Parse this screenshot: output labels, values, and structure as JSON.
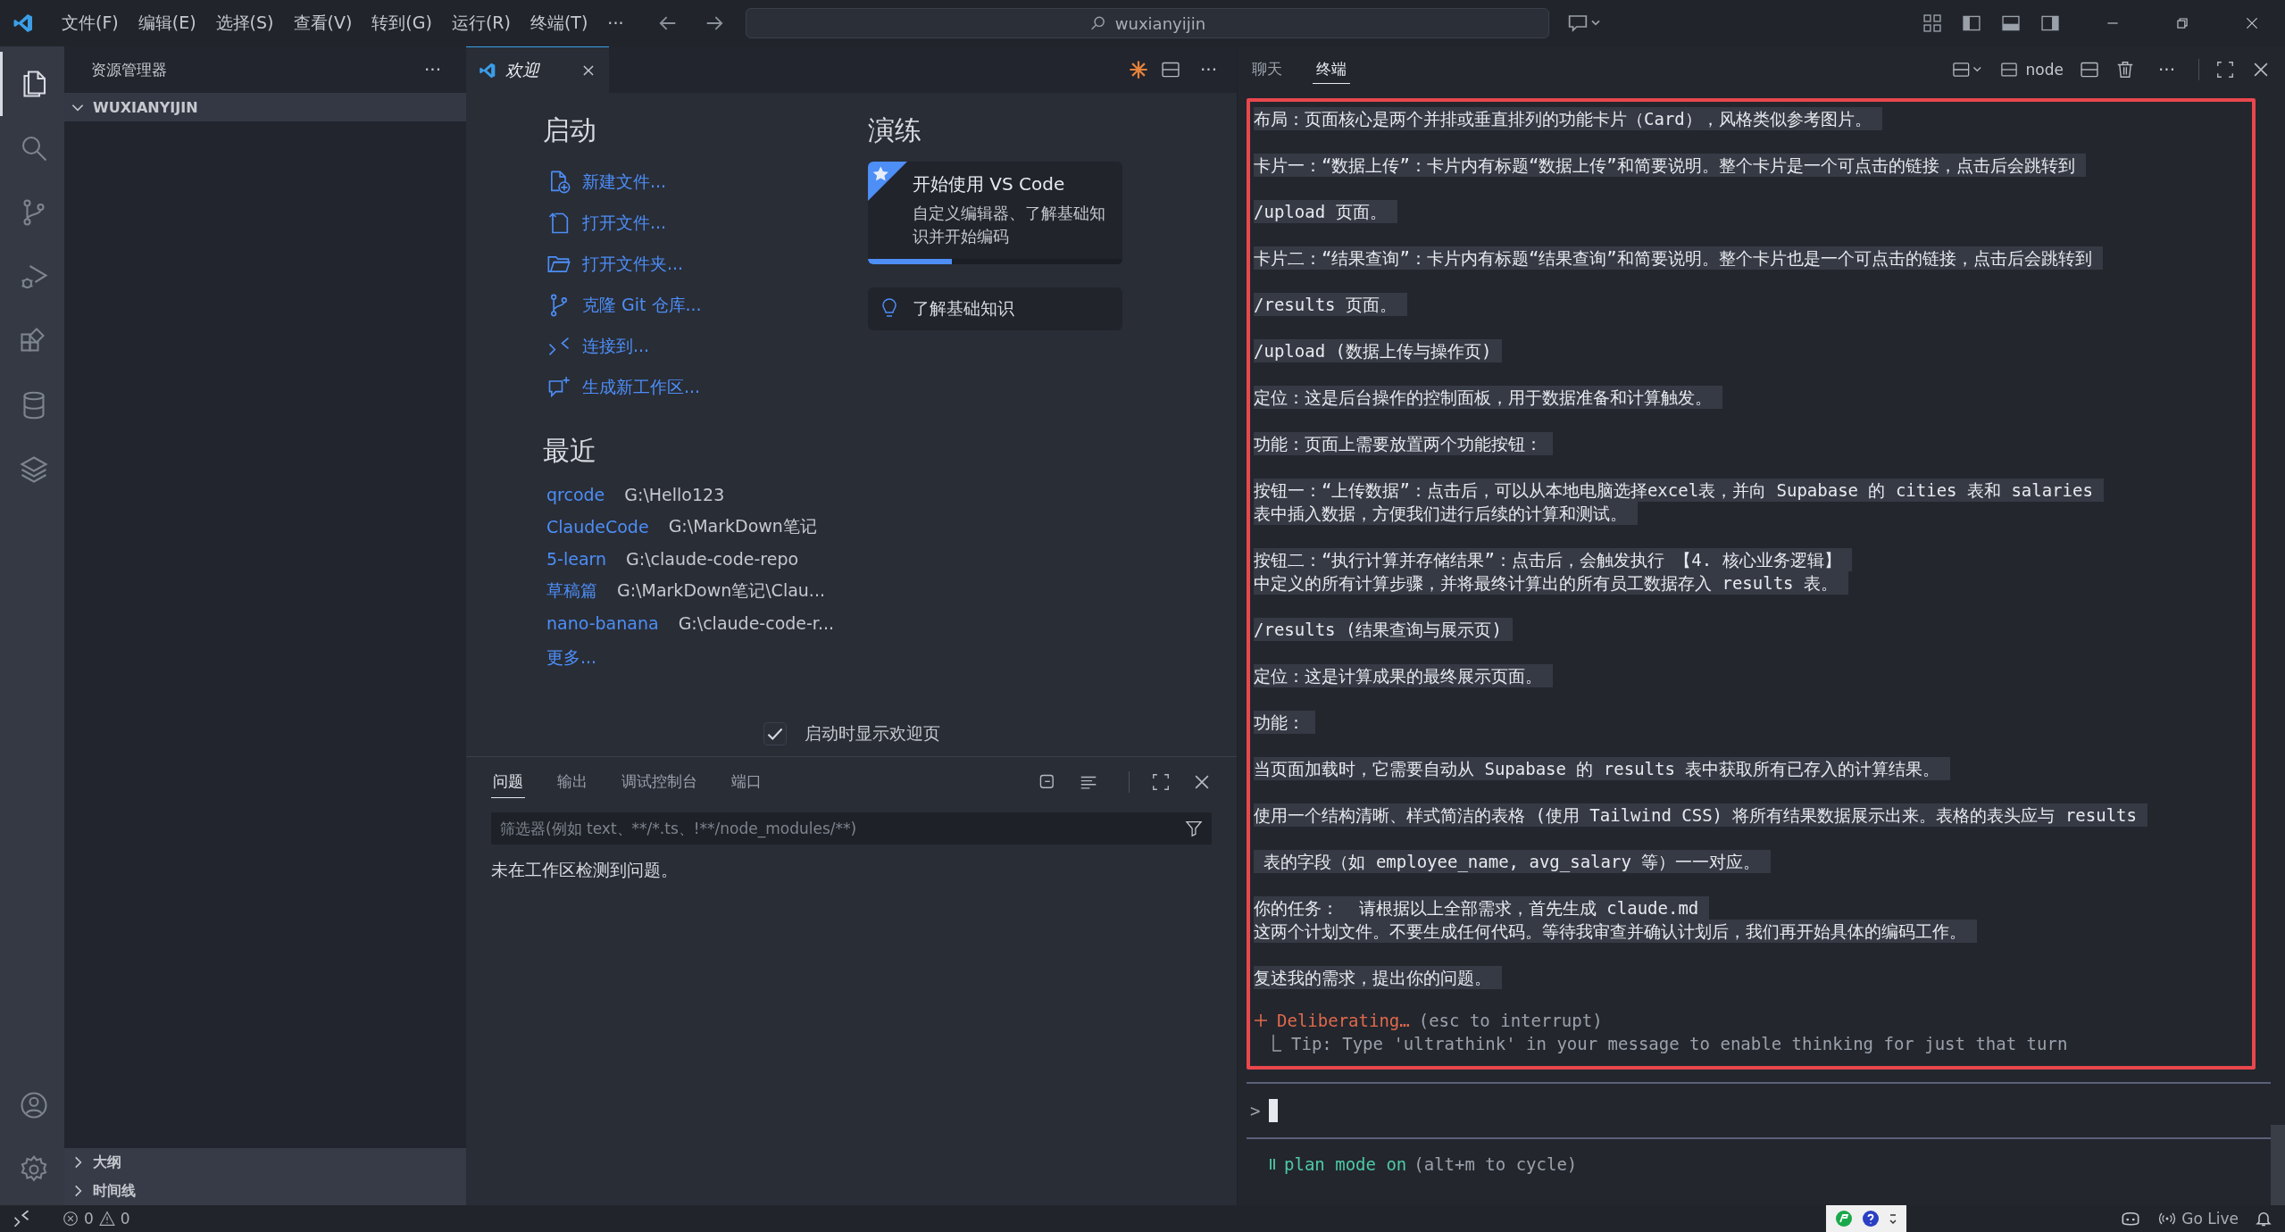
{
  "title_bar": {
    "menus": [
      "文件(F)",
      "编辑(E)",
      "选择(S)",
      "查看(V)",
      "转到(G)",
      "运行(R)",
      "终端(T)"
    ],
    "more": "···",
    "search": "wuxianyijin"
  },
  "activity_bar": {
    "items": [
      {
        "kind": "explorer",
        "selected": true
      },
      {
        "kind": "search",
        "selected": false
      },
      {
        "kind": "source-control",
        "selected": false
      },
      {
        "kind": "run-debug",
        "selected": false
      },
      {
        "kind": "extensions",
        "selected": false
      },
      {
        "kind": "database",
        "selected": false
      },
      {
        "kind": "layers",
        "selected": false
      }
    ],
    "bottom": [
      {
        "kind": "account"
      },
      {
        "kind": "settings"
      }
    ]
  },
  "sidebar": {
    "title": "资源管理器",
    "more": "···",
    "folder": {
      "name": "WUXIANYIJIN",
      "expanded": true
    },
    "sections": [
      {
        "label": "大纲",
        "expanded": false
      },
      {
        "label": "时间线",
        "expanded": false
      }
    ]
  },
  "editor": {
    "tabs": [
      {
        "label": "欢迎",
        "selected": true
      }
    ],
    "more": "···"
  },
  "welcome": {
    "start": {
      "title": "启动",
      "items": [
        {
          "kind": "new-file",
          "label": "新建文件..."
        },
        {
          "kind": "open-file",
          "label": "打开文件..."
        },
        {
          "kind": "open-folder",
          "label": "打开文件夹..."
        },
        {
          "kind": "clone",
          "label": "克隆 Git 仓库..."
        },
        {
          "kind": "connect",
          "label": "连接到..."
        },
        {
          "kind": "generate",
          "label": "生成新工作区..."
        }
      ]
    },
    "walkthroughs": {
      "title": "演练",
      "cards": [
        {
          "kind": "featured",
          "title": "开始使用 VS Code",
          "description": "自定义编辑器、了解基础知识并开始编码",
          "level": 0.33
        },
        {
          "kind": "basic",
          "title": "了解基础知识"
        }
      ]
    },
    "recent": {
      "title": "最近",
      "items": [
        {
          "name": "qrcode",
          "path": "G:\\Hello123"
        },
        {
          "name": "ClaudeCode",
          "path": "G:\\MarkDown笔记"
        },
        {
          "name": "5-learn",
          "path": "G:\\claude-code-repo"
        },
        {
          "name": "草稿篇",
          "path": "G:\\MarkDown笔记\\Clau..."
        },
        {
          "name": "nano-banana",
          "path": "G:\\claude-code-r..."
        }
      ],
      "more": "更多..."
    },
    "show_on_startup": {
      "label": "启动时显示欢迎页",
      "checked": true
    }
  },
  "panel": {
    "tabs": [
      {
        "label": "问题",
        "selected": true
      },
      {
        "label": "输出",
        "selected": false
      },
      {
        "label": "调试控制台",
        "selected": false
      },
      {
        "label": "端口",
        "selected": false
      }
    ],
    "filter": {
      "placeholder": "筛选器(例如 text、**/*.ts、!**/node_modules/**)"
    },
    "message": "未在工作区检测到问题。"
  },
  "secondary": {
    "tabs": [
      {
        "label": "聊天",
        "selected": false
      },
      {
        "label": "终端",
        "selected": true
      }
    ],
    "terminal_name": "node",
    "more": "···",
    "output": [
      [
        "布局：页面核心是两个并排或垂直排列的功能卡片（Card），风格类似参考图片。"
      ],
      [
        "卡片一：“数据上传”：卡片内有标题“数据上传”和简要说明。整个卡片是一个可点击的链接，点击后会跳转到"
      ],
      [
        "/upload 页面。"
      ],
      [
        "卡片二：“结果查询”：卡片内有标题“结果查询”和简要说明。整个卡片也是一个可点击的链接，点击后会跳转到"
      ],
      [
        "/results 页面。"
      ],
      [
        "/upload (数据上传与操作页)"
      ],
      [
        "定位：这是后台操作的控制面板，用于数据准备和计算触发。"
      ],
      [
        "功能：页面上需要放置两个功能按钮："
      ],
      [
        "按钮一：“上传数据”：点击后，可以从本地电脑选择excel表，并向 Supabase 的 cities 表和 salaries",
        "表中插入数据，方便我们进行后续的计算和测试。"
      ],
      [
        "按钮二：“执行计算并存储结果”：点击后，会触发执行 【4. 核心业务逻辑】",
        "中定义的所有计算步骤，并将最终计算出的所有员工数据存入 results 表。"
      ],
      [
        "/results (结果查询与展示页)"
      ],
      [
        "定位：这是计算成果的最终展示页面。"
      ],
      [
        "功能："
      ],
      [
        "当页面加载时，它需要自动从 Supabase 的 results 表中获取所有已存入的计算结果。"
      ],
      [
        "使用一个结构清晰、样式简洁的表格 (使用 Tailwind CSS) 将所有结果数据展示出来。表格的表头应与 results"
      ],
      [
        " 表的字段（如 employee_name, avg_salary 等）一一对应。"
      ],
      [
        "你的任务：  请根据以上全部需求，首先生成 claude.md",
        "这两个计划文件。不要生成任何代码。等待我审查并确认计划后，我们再开始具体的编码工作。"
      ],
      [
        "复述我的需求，提出你的问题。"
      ]
    ],
    "status": {
      "word": "Deliberating…",
      "hint": "(esc to interrupt)"
    },
    "tip": "Tip: Type 'ultrathink' in your message to enable thinking for just that turn",
    "prompt": ">",
    "mode": {
      "label": "plan mode on",
      "hint": "(alt+m to cycle)"
    }
  },
  "status_bar": {
    "errors": "0",
    "warnings": "0",
    "go_live": "Go Live"
  }
}
